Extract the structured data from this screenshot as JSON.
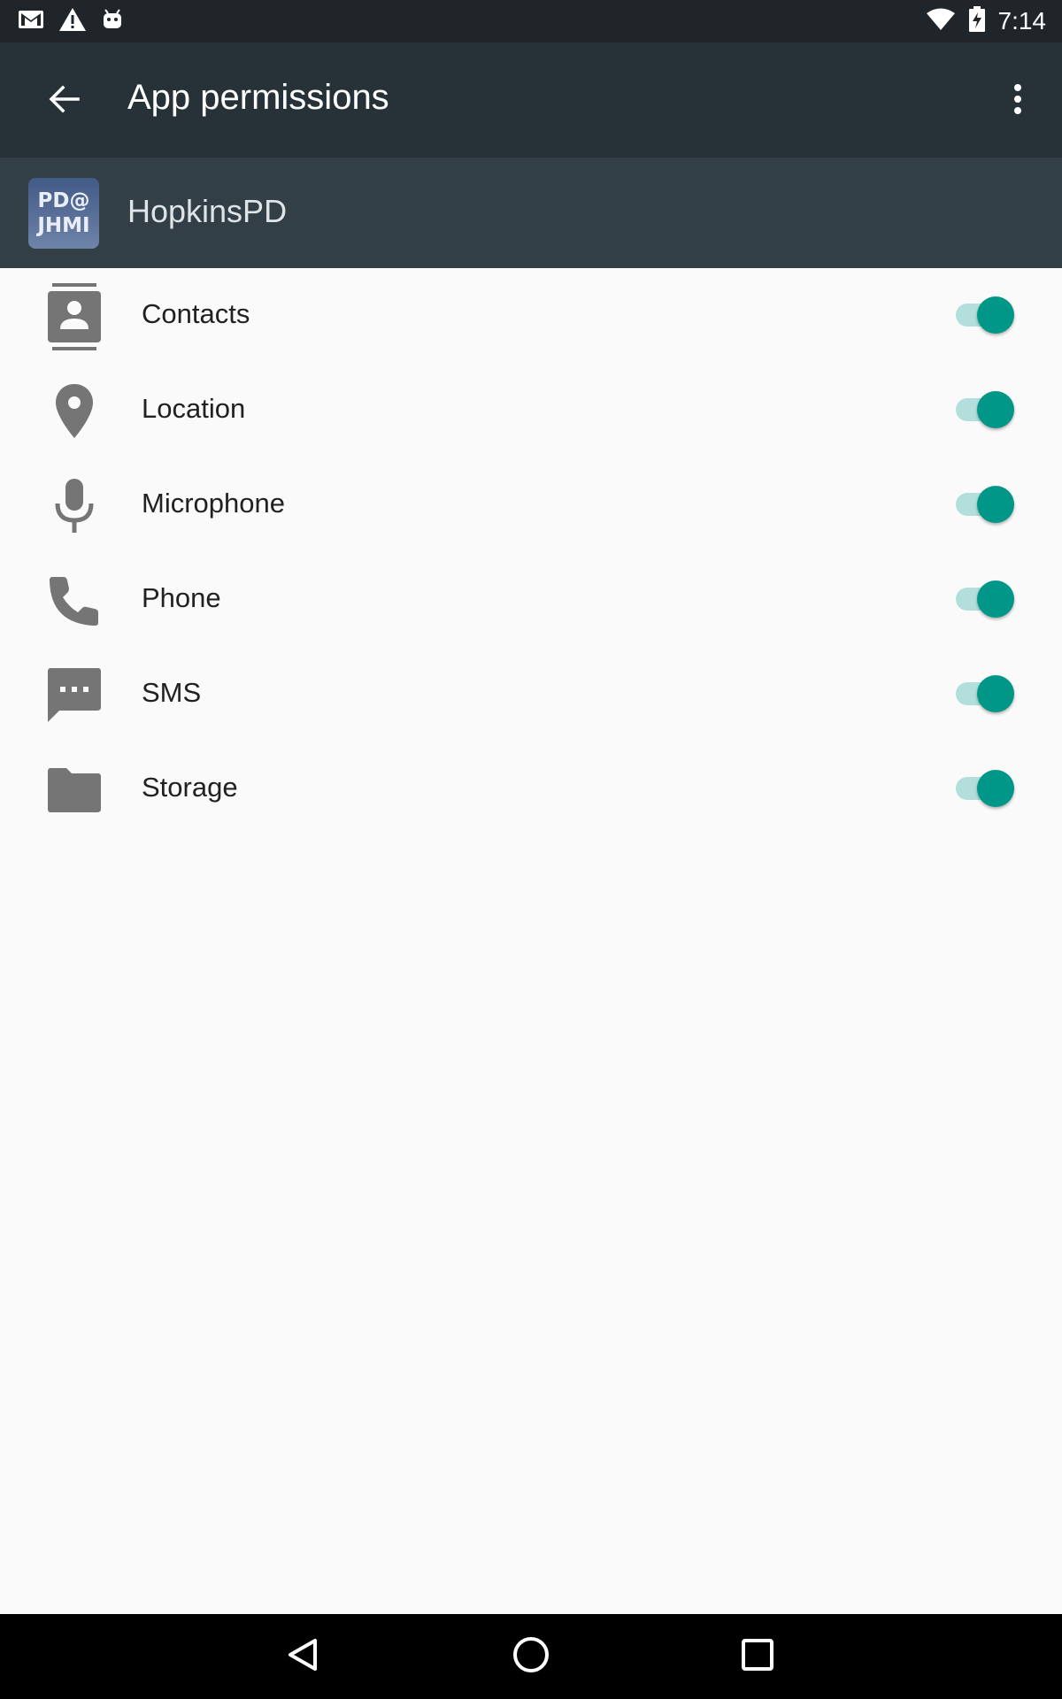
{
  "status_bar": {
    "time": "7:14",
    "left_icons": [
      "gmail-icon",
      "warning-icon",
      "android-icon"
    ],
    "right_icons": [
      "wifi-icon",
      "battery-charging-icon"
    ]
  },
  "toolbar": {
    "title": "App permissions",
    "background": "#263238"
  },
  "app": {
    "name": "HopkinsPD",
    "icon_text_line1": "PD@",
    "icon_text_line2": "JHMI"
  },
  "permissions": [
    {
      "label": "Contacts",
      "icon": "contacts-icon",
      "enabled": true
    },
    {
      "label": "Location",
      "icon": "location-pin-icon",
      "enabled": true
    },
    {
      "label": "Microphone",
      "icon": "microphone-icon",
      "enabled": true
    },
    {
      "label": "Phone",
      "icon": "phone-icon",
      "enabled": true
    },
    {
      "label": "SMS",
      "icon": "sms-icon",
      "enabled": true
    },
    {
      "label": "Storage",
      "icon": "folder-icon",
      "enabled": true
    }
  ],
  "colors": {
    "accent": "#009688",
    "track_on": "#b2dfdb",
    "icon_gray": "#757575"
  },
  "nav_bar": {
    "buttons": [
      "back-triangle-icon",
      "home-circle-icon",
      "recents-square-icon"
    ]
  }
}
